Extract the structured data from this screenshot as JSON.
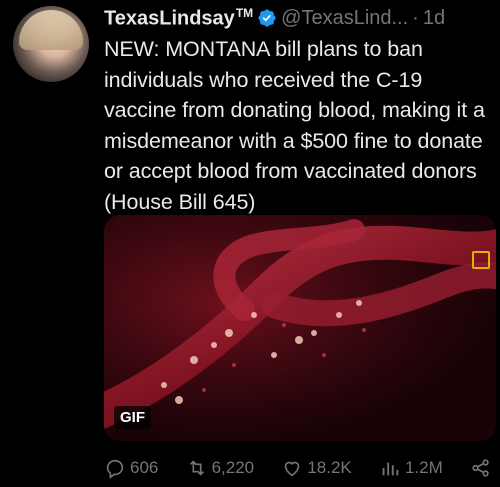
{
  "tweet": {
    "display_name": "TexasLindsay",
    "name_suffix": "TM",
    "handle": "@TexasLind...",
    "separator": "·",
    "time": "1d",
    "text": "NEW: MONTANA bill plans to ban individuals who received the C-19 vaccine from donating blood, making it a misdemeanor with a $500 fine to donate or accept blood from vaccinated donors (House Bill 645)",
    "media_badge": "GIF"
  },
  "actions": {
    "replies": "606",
    "retweets": "6,220",
    "likes": "18.2K",
    "views": "1.2M"
  },
  "colors": {
    "background": "#000000",
    "text": "#e7e9ea",
    "muted": "#71767b",
    "verified": "#1d9bf0"
  }
}
